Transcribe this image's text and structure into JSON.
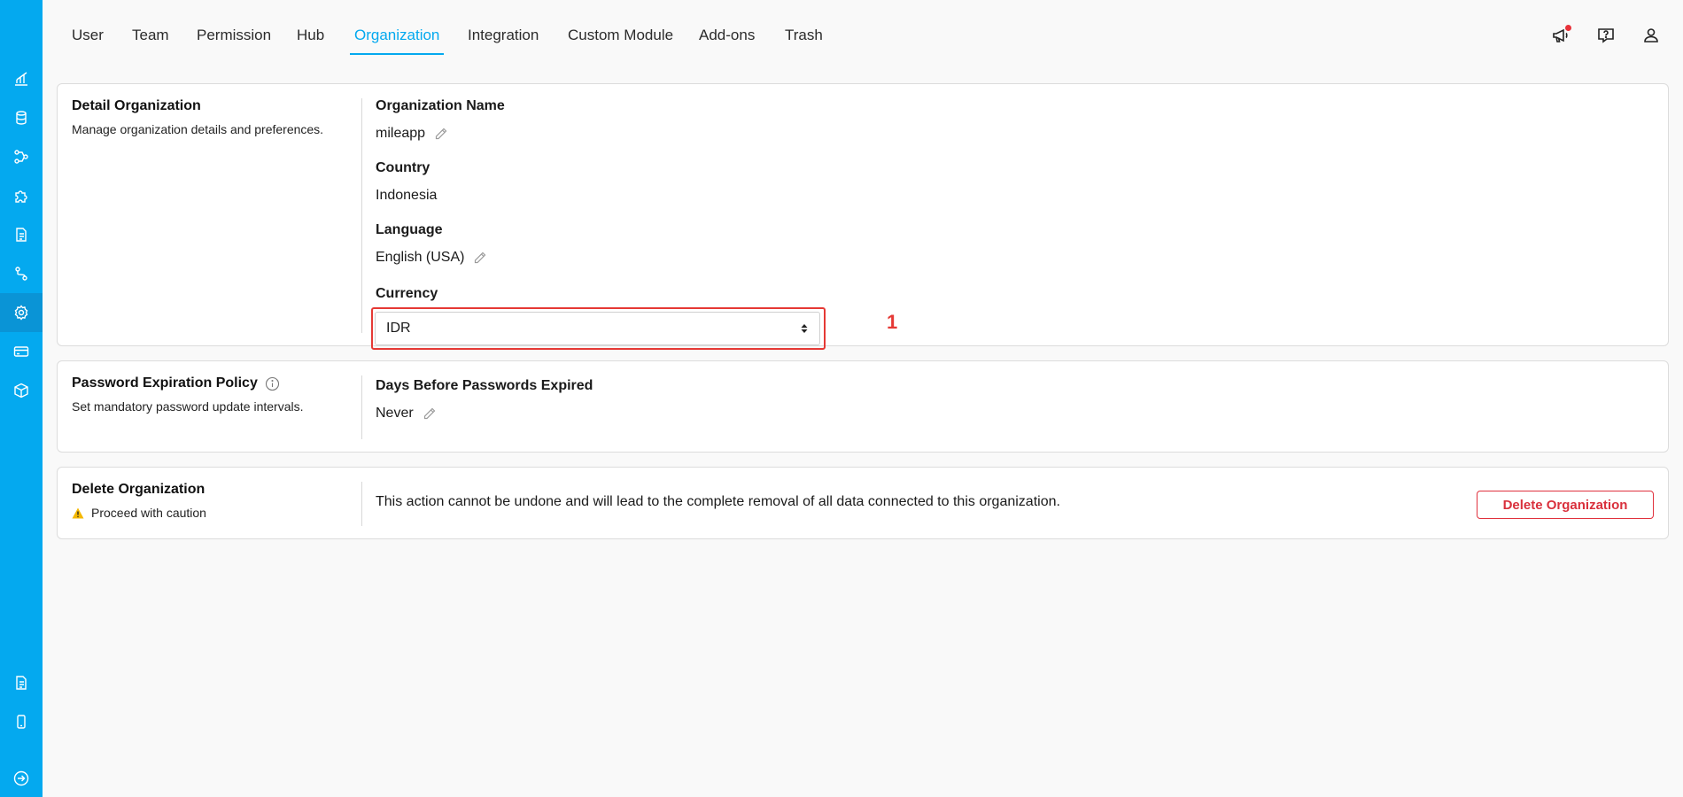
{
  "sidebar": {
    "items": [
      {
        "icon": "analytics-icon"
      },
      {
        "icon": "database-icon"
      },
      {
        "icon": "workflow-icon"
      },
      {
        "icon": "puzzle-icon"
      },
      {
        "icon": "document-icon"
      },
      {
        "icon": "route-icon"
      },
      {
        "icon": "settings-icon",
        "active": true
      },
      {
        "icon": "credit-card-icon"
      },
      {
        "icon": "package-icon"
      }
    ],
    "bottom_items": [
      {
        "icon": "report-icon"
      },
      {
        "icon": "mobile-icon"
      },
      {
        "icon": "logout-icon"
      }
    ]
  },
  "nav": {
    "tabs": [
      "User",
      "Team",
      "Permission",
      "Hub",
      "Organization",
      "Integration",
      "Custom Module",
      "Add-ons",
      "Trash"
    ],
    "active_tab": "Organization"
  },
  "header_icons": [
    "announcement-icon",
    "help-icon",
    "user-icon"
  ],
  "detail": {
    "title": "Detail Organization",
    "description": "Manage organization details and preferences.",
    "org_name_label": "Organization Name",
    "org_name_value": "mileapp",
    "country_label": "Country",
    "country_value": "Indonesia",
    "language_label": "Language",
    "language_value": "English (USA)",
    "currency_label": "Currency",
    "currency_value": "IDR",
    "annotation": "1"
  },
  "password_policy": {
    "title": "Password Expiration Policy",
    "description": "Set mandatory password update intervals.",
    "days_label": "Days Before Passwords Expired",
    "days_value": "Never"
  },
  "delete_org": {
    "title": "Delete Organization",
    "caution": "Proceed with caution",
    "message": "This action cannot be undone and will lead to the complete removal of all data connected to this organization.",
    "button_label": "Delete Organization"
  },
  "colors": {
    "accent": "#04a9ef",
    "danger": "#e0313d",
    "warning": "#f5b800"
  }
}
